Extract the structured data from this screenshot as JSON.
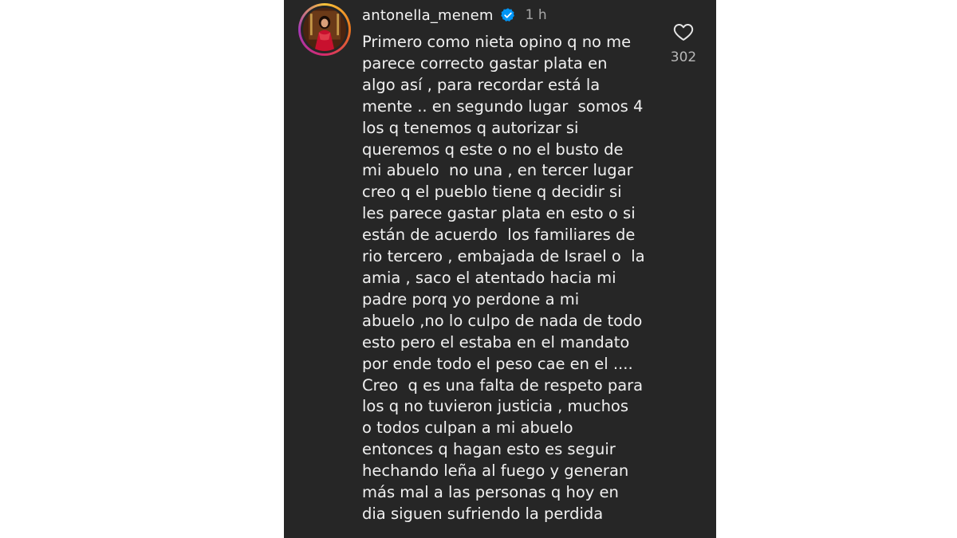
{
  "comment": {
    "username": "antonella_menem",
    "verified_icon": "verified-badge-icon",
    "timestamp": "1 h",
    "lines": [
      "Primero como nieta opino q no me",
      "parece correcto gastar plata en",
      "algo así , para recordar está la",
      "mente .. en segundo lugar  somos 4",
      "los q tenemos q autorizar si",
      "queremos q este o no el busto de",
      "mi abuelo  no una , en tercer lugar",
      "creo q el pueblo tiene q decidir si",
      "les parece gastar plata en esto o si",
      "están de acuerdo  los familiares de",
      "rio tercero , embajada de Israel o  la",
      "amia , saco el atentado hacia mi",
      "padre porq yo perdone a mi",
      "abuelo ,no lo culpo de nada de todo",
      "esto pero el estaba en el mandato",
      "por ende todo el peso cae en el ....",
      "Creo  q es una falta de respeto para",
      "los q no tuvieron justicia , muchos",
      "o todos culpan a mi abuelo",
      "entonces q hagan esto es seguir",
      "hechando leña al fuego y generan",
      "más mal a las personas q hoy en",
      "dia siguen sufriendo la perdida"
    ],
    "like_icon": "heart-icon",
    "like_count": "302"
  },
  "colors": {
    "panel_background": "#262626",
    "page_background": "#ffffff",
    "text_primary": "#f0f0f0",
    "text_secondary": "#a8a8a8",
    "verified_blue": "#0095f6"
  }
}
